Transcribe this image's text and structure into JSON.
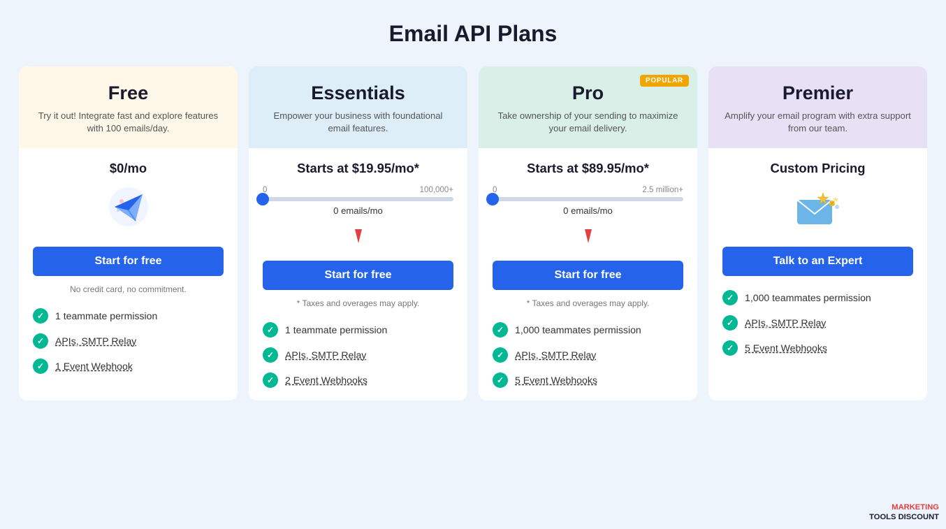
{
  "page": {
    "title": "Email API Plans"
  },
  "plans": [
    {
      "id": "free",
      "name": "Free",
      "description": "Try it out! Integrate fast and explore features with 100 emails/day.",
      "price": "$0/mo",
      "cta": "Start for free",
      "note": "No credit card, no commitment.",
      "popular": false,
      "header_class": "free",
      "icon_type": "plane",
      "slider": false,
      "features": [
        {
          "text": "1 teammate permission",
          "link": false
        },
        {
          "text": "APIs, SMTP Relay",
          "link": true
        },
        {
          "text": "1 Event Webhook",
          "link": true
        }
      ]
    },
    {
      "id": "essentials",
      "name": "Essentials",
      "description": "Empower your business with foundational email features.",
      "price": "Starts at $19.95/mo*",
      "cta": "Start for free",
      "note": "* Taxes and overages may apply.",
      "popular": false,
      "header_class": "essentials",
      "icon_type": "none",
      "slider": true,
      "slider_min": "0",
      "slider_max": "100,000+",
      "slider_value": "0 emails/mo",
      "features": [
        {
          "text": "1 teammate permission",
          "link": false
        },
        {
          "text": "APIs, SMTP Relay",
          "link": true
        },
        {
          "text": "2 Event Webhooks",
          "link": true
        }
      ]
    },
    {
      "id": "pro",
      "name": "Pro",
      "description": "Take ownership of your sending to maximize your email delivery.",
      "price": "Starts at $89.95/mo*",
      "cta": "Start for free",
      "note": "* Taxes and overages may apply.",
      "popular": true,
      "popular_label": "POPULAR",
      "header_class": "pro",
      "icon_type": "none",
      "slider": true,
      "slider_min": "0",
      "slider_max": "2.5 million+",
      "slider_value": "0 emails/mo",
      "features": [
        {
          "text": "1,000 teammates permission",
          "link": false
        },
        {
          "text": "APIs, SMTP Relay",
          "link": true
        },
        {
          "text": "5 Event Webhooks",
          "link": true
        }
      ]
    },
    {
      "id": "premier",
      "name": "Premier",
      "description": "Amplify your email program with extra support from our team.",
      "price": "Custom Pricing",
      "cta": "Talk to an Expert",
      "note": "",
      "popular": false,
      "header_class": "premier",
      "icon_type": "star_envelope",
      "slider": false,
      "features": [
        {
          "text": "1,000 teammates permission",
          "link": false
        },
        {
          "text": "APIs, SMTP Relay",
          "link": true
        },
        {
          "text": "5 Event Webhooks",
          "link": true
        }
      ]
    }
  ],
  "watermark": {
    "line1": "MARKETING",
    "line2": "TOOLS DISCOUNT"
  }
}
